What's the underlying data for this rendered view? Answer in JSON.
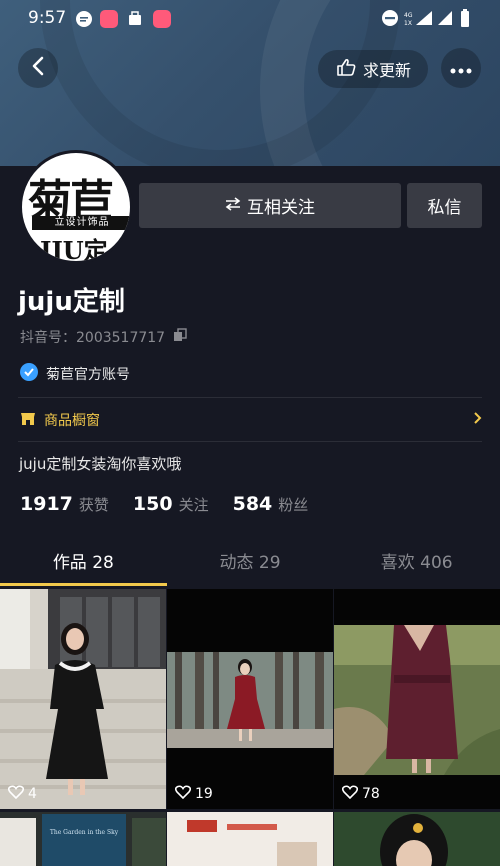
{
  "status_bar": {
    "time": "9:57"
  },
  "header": {
    "request_update_label": "求更新"
  },
  "avatar": {
    "line1": "菊苣",
    "line2": "立设计饰品",
    "line3": "JJU定"
  },
  "actions": {
    "mutual_follow_label": "互相关注",
    "message_label": "私信"
  },
  "profile": {
    "nickname": "juju定制",
    "douyin_id": "抖音号：2003517717",
    "verified_label": "菊苣官方账号",
    "shop_label": "商品橱窗",
    "bio": "juju定制女装淘你喜欢哦"
  },
  "stats": [
    {
      "value": "1917",
      "label": "获赞"
    },
    {
      "value": "150",
      "label": "关注"
    },
    {
      "value": "584",
      "label": "粉丝"
    }
  ],
  "tabs": [
    {
      "label": "作品 28",
      "active": true
    },
    {
      "label": "动态 29",
      "active": false
    },
    {
      "label": "喜欢 406",
      "active": false
    }
  ],
  "videos": [
    {
      "likes": "4"
    },
    {
      "likes": "19"
    },
    {
      "likes": "78"
    }
  ],
  "partial_video_texts": {
    "book_title": "The Garden in the Sky"
  },
  "colors": {
    "background": "#161823",
    "accent": "#f2c94c",
    "button": "#393b44",
    "verified": "#3aa0ff"
  }
}
